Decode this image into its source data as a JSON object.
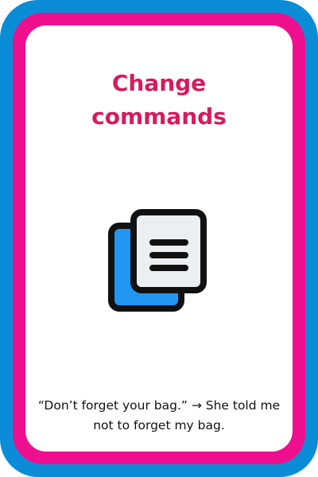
{
  "card": {
    "title_line1": "Change",
    "title_line2": "commands",
    "icon": "copy-document-icon",
    "caption": "“Don’t forget your bag.” → She told me not to forget my bag.",
    "colors": {
      "outer_border": "#0a8dd6",
      "inner_border": "#ee0f8f",
      "title": "#d61b5c",
      "icon_back": "#2196f3",
      "icon_front": "#eceff1",
      "icon_stroke": "#111111"
    }
  }
}
